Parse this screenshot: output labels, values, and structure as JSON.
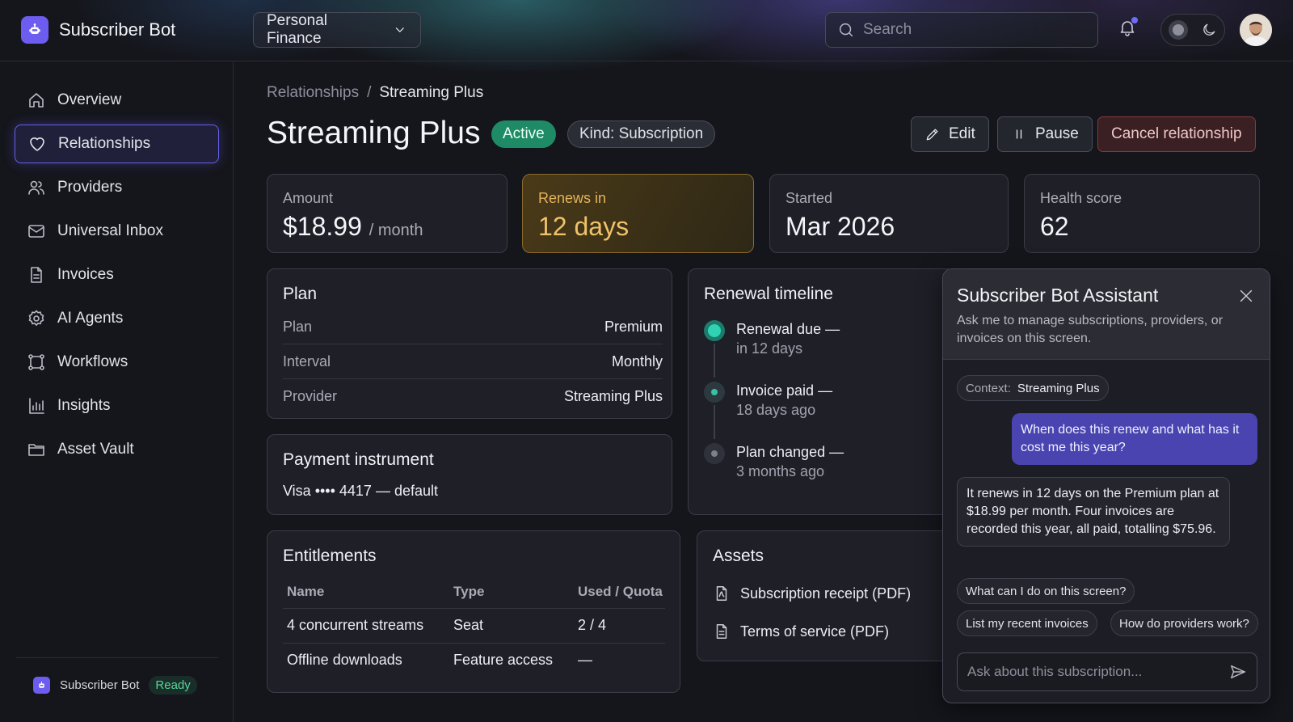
{
  "app": {
    "name": "Subscriber Bot"
  },
  "header": {
    "workspace": "Personal Finance",
    "search_placeholder": "Search"
  },
  "sidebar": {
    "items": [
      {
        "label": "Overview",
        "icon": "home-icon"
      },
      {
        "label": "Relationships",
        "icon": "heart-icon",
        "active": true
      },
      {
        "label": "Providers",
        "icon": "users-icon"
      },
      {
        "label": "Universal Inbox",
        "icon": "mail-icon"
      },
      {
        "label": "Invoices",
        "icon": "document-icon"
      },
      {
        "label": "AI Agents",
        "icon": "gear-icon"
      },
      {
        "label": "Workflows",
        "icon": "workflow-icon"
      },
      {
        "label": "Insights",
        "icon": "bar-chart-icon"
      },
      {
        "label": "Asset Vault",
        "icon": "folder-icon"
      }
    ],
    "footer": {
      "name": "Subscriber Bot",
      "status": "Ready"
    }
  },
  "breadcrumb": {
    "parent": "Relationships",
    "separator": "/",
    "current": "Streaming Plus"
  },
  "page": {
    "title": "Streaming Plus",
    "status": "Active",
    "kind": "Kind: Subscription",
    "actions": {
      "edit": "Edit",
      "pause": "Pause",
      "cancel": "Cancel relationship"
    }
  },
  "stats": {
    "amount": {
      "label": "Amount",
      "value": "$18.99",
      "unit": "/ month"
    },
    "renews": {
      "label": "Renews in",
      "value": "12 days"
    },
    "started": {
      "label": "Started",
      "value": "Mar 2026"
    },
    "health": {
      "label": "Health score",
      "value": "62"
    }
  },
  "plan": {
    "title": "Plan",
    "rows": [
      {
        "k": "Plan",
        "v": "Premium"
      },
      {
        "k": "Interval",
        "v": "Monthly"
      },
      {
        "k": "Provider",
        "v": "Streaming Plus"
      }
    ]
  },
  "payment": {
    "title": "Payment instrument",
    "value": "Visa •••• 4417 — default"
  },
  "timeline": {
    "title": "Renewal timeline",
    "events": [
      {
        "label": "Renewal due —",
        "sub": "in 12 days"
      },
      {
        "label": "Invoice paid —",
        "sub": "18 days ago"
      },
      {
        "label": "Plan changed —",
        "sub": "3 months ago"
      }
    ]
  },
  "entitlements": {
    "title": "Entitlements",
    "headers": [
      "Name",
      "Type",
      "Used / Quota"
    ],
    "rows": [
      [
        "4 concurrent streams",
        "Seat",
        "2 / 4"
      ],
      [
        "Offline downloads",
        "Feature access",
        "—"
      ]
    ]
  },
  "assets": {
    "title": "Assets",
    "items": [
      "Subscription receipt (PDF)",
      "Terms of service (PDF)"
    ]
  },
  "assistant": {
    "title": "Subscriber Bot Assistant",
    "subtitle": "Ask me to manage subscriptions, providers, or invoices on this screen.",
    "context_label": "Context:",
    "context_value": "Streaming Plus",
    "user_message": "When does this renew and what has it cost me this year?",
    "bot_message": "It renews in 12 days on the Premium plan at $18.99 per month. Four invoices are recorded this year, all paid, totalling $75.96.",
    "suggestions": [
      "What can I do on this screen?",
      "List my recent invoices",
      "How do providers work?"
    ],
    "input_placeholder": "Ask about this subscription..."
  },
  "colors": {
    "accent": "#6d5cf0",
    "active_badge": "#1f8a66",
    "renew_text": "#f0c26a",
    "ready": "#59d49a"
  }
}
